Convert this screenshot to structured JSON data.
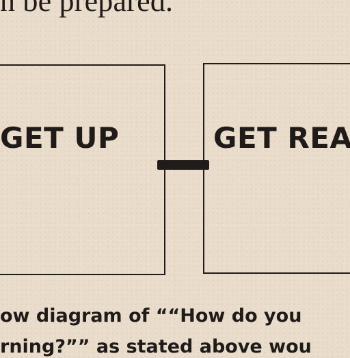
{
  "top_text": "n be prepared.",
  "boxes": {
    "left_label": "GET  UP",
    "right_label": "GET REA"
  },
  "caption": {
    "line1": "ow diagram of ““How do you",
    "line2": "rning?”” as stated above wou"
  }
}
